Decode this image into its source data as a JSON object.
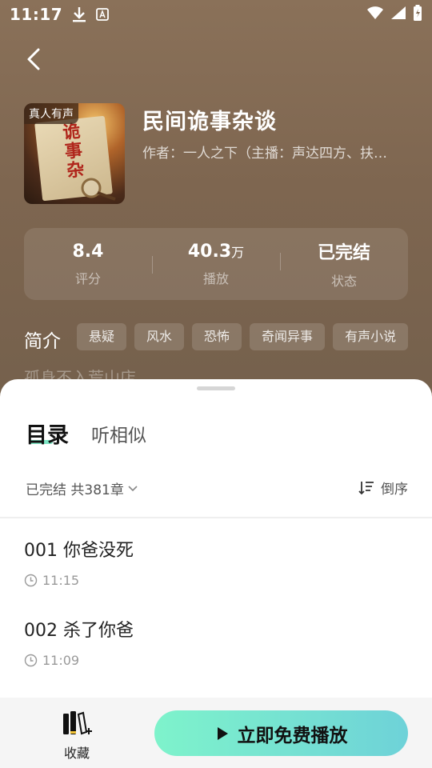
{
  "status_bar": {
    "time": "11:17",
    "icons": [
      "download-icon",
      "font-app-icon",
      "wifi-icon",
      "signal-icon",
      "battery-charging-icon"
    ]
  },
  "book": {
    "cover_badge": "真人有声",
    "title": "民间诡事杂谈",
    "author": "作者：一人之下（主播：声达四方、扶…"
  },
  "stats": [
    {
      "value": "8.4",
      "unit": "",
      "label": "评分"
    },
    {
      "value": "40.3",
      "unit": "万",
      "label": "播放"
    },
    {
      "value": "已完结",
      "unit": "",
      "label": "状态"
    }
  ],
  "intro": {
    "label": "简介",
    "tags": [
      "悬疑",
      "风水",
      "恐怖",
      "奇闻异事",
      "有声小说"
    ],
    "text": "孤身不入荒山店"
  },
  "sheet": {
    "tabs": [
      "目录",
      "听相似"
    ],
    "filter_label": "已完结 共381章",
    "sort_label": "倒序",
    "chapters": [
      {
        "title": "001 你爸没死",
        "duration": "11:15"
      },
      {
        "title": "002 杀了你爸",
        "duration": "11:09"
      }
    ]
  },
  "bottom_bar": {
    "favorite_label": "收藏",
    "play_label": "立即免费播放"
  },
  "colors": {
    "accent_start": "#7ef3cb",
    "accent_end": "#6ed2d8"
  }
}
